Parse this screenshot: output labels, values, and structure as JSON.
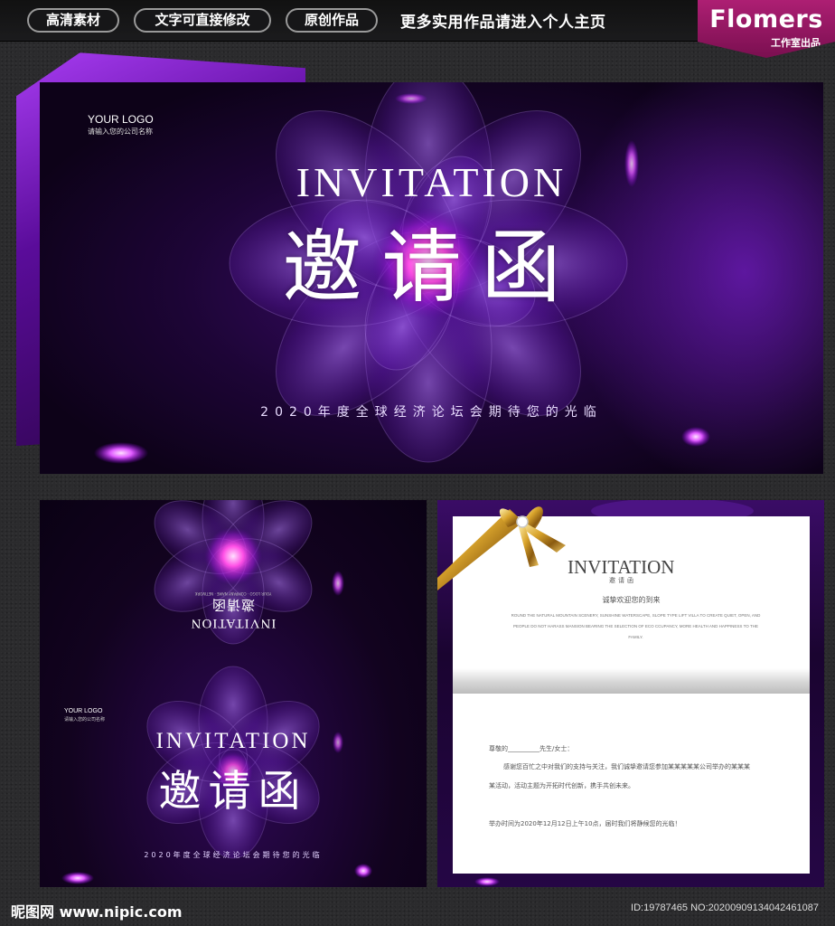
{
  "topbar": {
    "tags": [
      "高清素材",
      "文字可直接修改",
      "原创作品"
    ],
    "promo": "更多实用作品请进入个人主页",
    "brand_name": "Flomers",
    "brand_sub": "工作室出品"
  },
  "hero": {
    "logo_title": "YOUR LOGO",
    "logo_sub": "请输入您的公司名称",
    "invitation": "INVITATION",
    "title": "邀请函",
    "subtitle": "2020年度全球经济论坛会期待您的光临"
  },
  "cover": {
    "mirror_invitation": "INVITATION",
    "mirror_title": "邀请函",
    "mirror_small": "YOUR LOGO · COMPANY NAME · NETWORK",
    "logo_title": "YOUR LOGO",
    "logo_sub": "请输入您的公司名称",
    "invitation": "INVITATION",
    "title": "邀请函",
    "subtitle": "2020年度全球经济论坛会期待您的光临"
  },
  "inside": {
    "invitation": "INVITATION",
    "small_title": "邀请函",
    "welcome": "诚挚欢迎您的到来",
    "english": "ROUND THE NATURAL MOUNTAIN SCENERY, SUNSHINE WATERSCAPE, SLOPE TYPE LIFT VILLA TO CREATE QUIET, OPEN, AND PEOPLE DO NOT HARASS MANSION BEARING THE SELECTION OF ECO CCUPANCY, MORE HEALTH AND HAPPINESS TO THE FAMILY.",
    "salutation": "尊敬的__________先生/女士：",
    "body_1": "感谢您百忙之中对我们的支持与关注，我们诚挚邀请您参加某某某某某公司举办的某某某",
    "body_2": "某活动，活动主题为开拓时代创新，携手共创未来。",
    "time_line": "举办时间为2020年12月12日上午10点，届时我们将静候您的光临！"
  },
  "watermark": {
    "site": "昵图网 www.nipic.com",
    "id": "ID:19787465 NO:20200909134042461087"
  },
  "colors": {
    "background": "#2b2b2d",
    "brand": "#ad1f73",
    "purple_deep": "#14031f",
    "accent": "#d040ff"
  }
}
